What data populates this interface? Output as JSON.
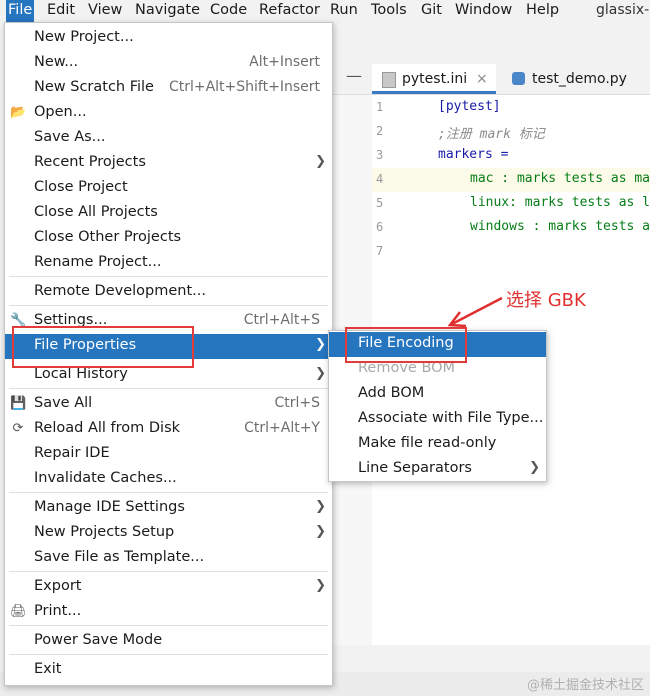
{
  "menubar": {
    "items": [
      "File",
      "Edit",
      "View",
      "Navigate",
      "Code",
      "Refactor",
      "Run",
      "Tools",
      "Git",
      "Window",
      "Help"
    ],
    "window_title": "glassix-"
  },
  "tabs": [
    {
      "label": "pytest.ini",
      "icon": "ini-file-icon"
    },
    {
      "label": "test_demo.py",
      "icon": "python-file-icon"
    }
  ],
  "editor": {
    "lines": [
      {
        "n": "1",
        "text": "[pytest]"
      },
      {
        "n": "2",
        "text": ";注册 mark 标记"
      },
      {
        "n": "3",
        "text": "markers ="
      },
      {
        "n": "4",
        "text": "mac : marks tests as ma"
      },
      {
        "n": "5",
        "text": "linux: marks tests as l"
      },
      {
        "n": "6",
        "text": "windows : marks tests a"
      },
      {
        "n": "7",
        "text": ""
      }
    ]
  },
  "annotation": "选择 GBK",
  "file_menu": {
    "items": [
      {
        "label": "New Project...",
        "shortcut": ""
      },
      {
        "label": "New...",
        "shortcut": "Alt+Insert"
      },
      {
        "label": "New Scratch File",
        "shortcut": "Ctrl+Alt+Shift+Insert"
      },
      {
        "label": "Open...",
        "shortcut": ""
      },
      {
        "label": "Save As...",
        "shortcut": ""
      },
      {
        "label": "Recent Projects",
        "shortcut": ""
      },
      {
        "label": "Close Project",
        "shortcut": ""
      },
      {
        "label": "Close All Projects",
        "shortcut": ""
      },
      {
        "label": "Close Other Projects",
        "shortcut": ""
      },
      {
        "label": "Rename Project...",
        "shortcut": ""
      },
      {
        "label": "Remote Development...",
        "shortcut": ""
      },
      {
        "label": "Settings...",
        "shortcut": "Ctrl+Alt+S"
      },
      {
        "label": "File Properties",
        "shortcut": ""
      },
      {
        "label": "Local History",
        "shortcut": ""
      },
      {
        "label": "Save All",
        "shortcut": "Ctrl+S"
      },
      {
        "label": "Reload All from Disk",
        "shortcut": "Ctrl+Alt+Y"
      },
      {
        "label": "Repair IDE",
        "shortcut": ""
      },
      {
        "label": "Invalidate Caches...",
        "shortcut": ""
      },
      {
        "label": "Manage IDE Settings",
        "shortcut": ""
      },
      {
        "label": "New Projects Setup",
        "shortcut": ""
      },
      {
        "label": "Save File as Template...",
        "shortcut": ""
      },
      {
        "label": "Export",
        "shortcut": ""
      },
      {
        "label": "Print...",
        "shortcut": ""
      },
      {
        "label": "Power Save Mode",
        "shortcut": ""
      },
      {
        "label": "Exit",
        "shortcut": ""
      }
    ]
  },
  "file_properties_menu": {
    "items": [
      {
        "label": "File Encoding"
      },
      {
        "label": "Remove BOM"
      },
      {
        "label": "Add BOM"
      },
      {
        "label": "Associate with File Type..."
      },
      {
        "label": "Make file read-only"
      },
      {
        "label": "Line Separators"
      }
    ]
  },
  "watermark": "@稀土掘金技术社区",
  "colors": {
    "selection": "#2675bf",
    "highlight_box": "#e23b3b",
    "annotation": "#e03030"
  }
}
